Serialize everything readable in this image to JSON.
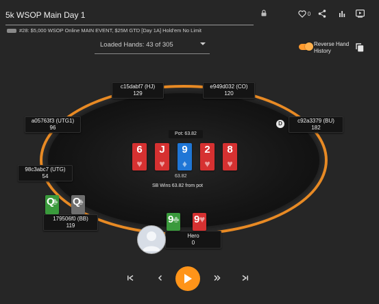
{
  "header": {
    "title": "5k WSOP Main Day 1",
    "subtitle": "#28: $5,000 WSOP Online MAIN EVENT, $25M GTD [Day 1A] Hold'em No Limit",
    "like_count": "0"
  },
  "hands_select": {
    "label": "Loaded Hands: 43 of 305"
  },
  "reverse_history": {
    "label_line1": "Reverse Hand",
    "label_line2": "History",
    "enabled": true
  },
  "seats": [
    {
      "id": "hj",
      "name": "c15dabf7 (HJ)",
      "stack": "129"
    },
    {
      "id": "co",
      "name": "e949d032 (CO)",
      "stack": "120"
    },
    {
      "id": "utg1",
      "name": "a05763f3 (UTG1)",
      "stack": "96"
    },
    {
      "id": "bu",
      "name": "c92a3379 (BU)",
      "stack": "182"
    },
    {
      "id": "utg",
      "name": "98c3abc7 (UTG)",
      "stack": "54"
    },
    {
      "id": "bb",
      "name": "179506f0 (BB)",
      "stack": "119"
    },
    {
      "id": "hero",
      "name": "Hero",
      "stack": "0"
    }
  ],
  "pot": {
    "label": "Pot: 63.82",
    "amount": "63.82",
    "result": "SB Wins 63.82 from pot"
  },
  "board": [
    {
      "rank": "6",
      "suit": "hearts",
      "color": "#d63131"
    },
    {
      "rank": "J",
      "suit": "hearts",
      "color": "#d63131"
    },
    {
      "rank": "9",
      "suit": "diamonds",
      "color": "#1f76d6"
    },
    {
      "rank": "2",
      "suit": "hearts",
      "color": "#d63131"
    },
    {
      "rank": "8",
      "suit": "hearts",
      "color": "#d63131"
    }
  ],
  "bb_cards": [
    {
      "rank": "Q",
      "suit": "clubs",
      "color": "#3a9a3c"
    },
    {
      "rank": "Q",
      "suit": "spades",
      "color": "#6e6e6e"
    }
  ],
  "hero_cards": [
    {
      "rank": "9",
      "suit": "clubs",
      "color": "#3a9a3c"
    },
    {
      "rank": "9",
      "suit": "hearts",
      "color": "#d63131"
    }
  ],
  "dealer_button": "D",
  "icons": {
    "lock": "lock-icon",
    "heart": "heart-icon",
    "share": "share-icon",
    "stats": "bar-chart-icon",
    "video": "video-icon",
    "copy": "copy-icon",
    "skip_start": "skip-start-icon",
    "prev": "prev-icon",
    "play": "play-icon",
    "fast_forward": "fast-forward-icon",
    "skip_end": "skip-end-icon"
  },
  "suit_glyphs": {
    "hearts": "♥",
    "diamonds": "♦",
    "clubs": "♣",
    "spades": "♠"
  },
  "accent_color": "#ff9419"
}
